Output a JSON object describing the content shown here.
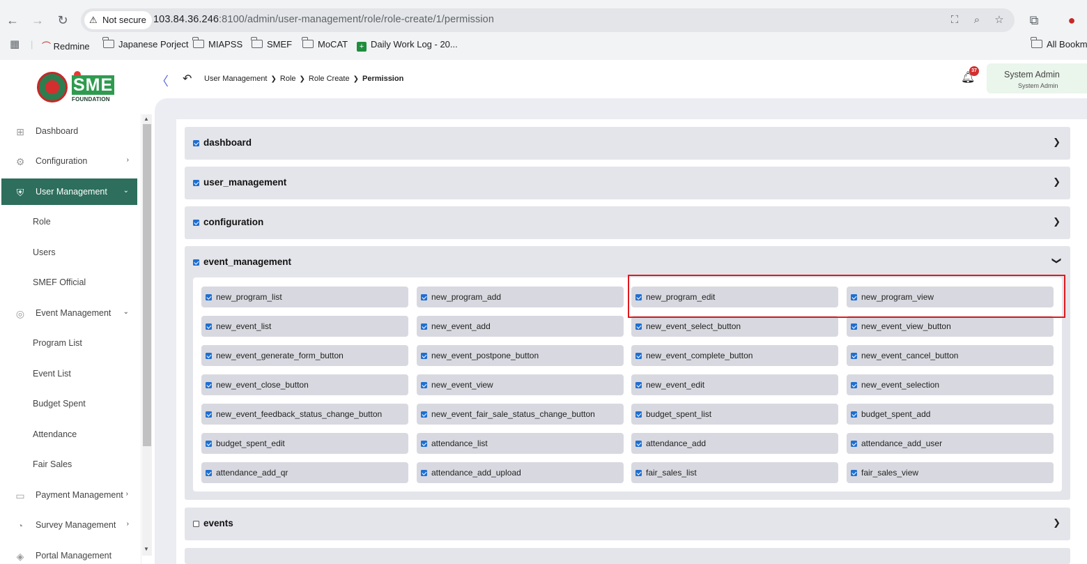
{
  "browser": {
    "not_secure": "Not secure",
    "url_host": "103.84.36.246",
    "url_rest": ":8100/admin/user-management/role/role-create/1/permission",
    "bookmarks": [
      "Redmine",
      "Japanese Porject",
      "MIAPSS",
      "SMEF",
      "MoCAT",
      "Daily Work Log - 20...",
      "All Bookm"
    ]
  },
  "header": {
    "logo_text": "SME",
    "logo_sub": "FOUNDATION",
    "breadcrumb": [
      "User Management",
      "Role",
      "Role Create",
      "Permission"
    ],
    "notification_count": "37",
    "user_name": "System Admin",
    "user_role": "System Admin"
  },
  "sidebar": {
    "items": [
      {
        "label": "Dashboard",
        "icon": "grid-icon"
      },
      {
        "label": "Configuration",
        "icon": "config-icon"
      },
      {
        "label": "User Management",
        "icon": "shield-icon"
      },
      {
        "label": "Event Management",
        "icon": "event-icon"
      },
      {
        "label": "Payment Management",
        "icon": "payment-icon"
      },
      {
        "label": "Survey Management",
        "icon": "survey-icon"
      },
      {
        "label": "Portal Management",
        "icon": "portal-icon"
      }
    ],
    "user_sub": [
      "Role",
      "Users",
      "SMEF Official"
    ],
    "event_sub": [
      "Program List",
      "Event List",
      "Budget Spent",
      "Attendance",
      "Fair Sales"
    ]
  },
  "sections": [
    {
      "title": "dashboard",
      "checked": true,
      "expanded": false
    },
    {
      "title": "user_management",
      "checked": true,
      "expanded": false
    },
    {
      "title": "configuration",
      "checked": true,
      "expanded": false
    },
    {
      "title": "event_management",
      "checked": true,
      "expanded": true
    },
    {
      "title": "events",
      "checked": false,
      "expanded": false
    }
  ],
  "permissions": [
    "new_program_list",
    "new_program_add",
    "new_program_edit",
    "new_program_view",
    "new_event_list",
    "new_event_add",
    "new_event_select_button",
    "new_event_view_button",
    "new_event_generate_form_button",
    "new_event_postpone_button",
    "new_event_complete_button",
    "new_event_cancel_button",
    "new_event_close_button",
    "new_event_view",
    "new_event_edit",
    "new_event_selection",
    "new_event_feedback_status_change_button",
    "new_event_fair_sale_status_change_button",
    "budget_spent_list",
    "budget_spent_add",
    "budget_spent_edit",
    "attendance_list",
    "attendance_add",
    "attendance_add_user",
    "attendance_add_qr",
    "attendance_add_upload",
    "fair_sales_list",
    "fair_sales_view"
  ],
  "colors": {
    "accent": "#2d6e5c",
    "checkbox": "#1f6fd1",
    "highlight": "#e0191e"
  }
}
